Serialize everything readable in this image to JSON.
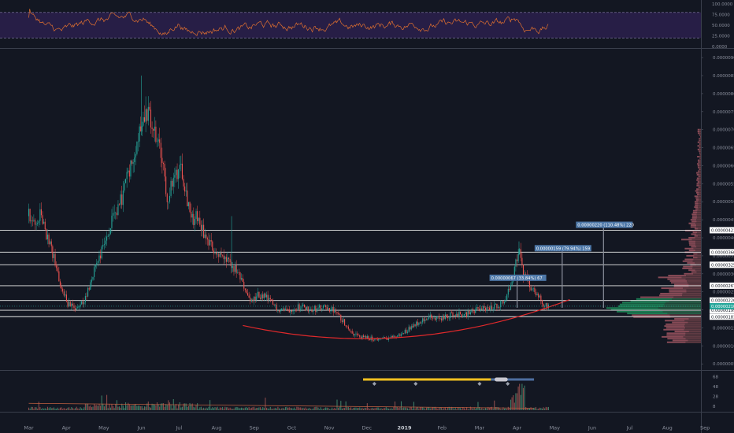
{
  "chart_data": {
    "type": "candlestick",
    "colors": {
      "background": "#131722",
      "up": "#26a69a",
      "down": "#ef5350",
      "rsi": "#e0702f",
      "rsi_band": "#2a1f4a",
      "arc": "#e0292b",
      "level": "#e8e8e8",
      "annotation": "#4e78a8",
      "profile_up": "#1f8f5c",
      "profile_down": "#9e5560",
      "timeline": "#4e6fa0",
      "timeline_fill": "#f0c020"
    },
    "x_axis": {
      "labels": [
        "Mar",
        "Apr",
        "May",
        "Jun",
        "Jul",
        "Aug",
        "Sep",
        "Oct",
        "Nov",
        "Dec",
        "2019",
        "Feb",
        "Mar",
        "Apr",
        "May",
        "Jun",
        "Jul",
        "Aug",
        "Sep"
      ],
      "bold_label": "2019"
    },
    "rsi": {
      "ticks": [
        "100.0000",
        "75.0000",
        "50.0000",
        "25.0000",
        "0.0000"
      ],
      "tick_values": [
        100,
        75,
        50,
        25,
        0
      ],
      "upper": 80,
      "lower": 20
    },
    "price": {
      "ticks": [
        "0.00000900",
        "0.00000850",
        "0.00000800",
        "0.00000750",
        "0.00000700",
        "0.00000650",
        "0.00000600",
        "0.00000550",
        "0.00000500",
        "0.00000450",
        "0.00000400",
        "0.00000350",
        "0.00000300",
        "0.00000250",
        "0.00000200",
        "0.00000150",
        "0.00000100",
        "0.00000050"
      ],
      "tick_values": [
        900,
        850,
        800,
        750,
        700,
        650,
        600,
        550,
        500,
        450,
        400,
        350,
        300,
        250,
        200,
        150,
        100,
        50
      ],
      "ylim": [
        33,
        920
      ],
      "current": "0.00000210",
      "current_value": 210
    },
    "levels": [
      {
        "value": 421,
        "label": "0.00000421"
      },
      {
        "value": 360,
        "label": "0.00000360"
      },
      {
        "value": 325,
        "label": "0.00000325"
      },
      {
        "value": 267,
        "label": "0.00000267"
      },
      {
        "value": 226,
        "label": "0.00000226"
      },
      {
        "value": 199,
        "label": "0.00000199"
      },
      {
        "value": 181,
        "label": "0.00000181"
      }
    ],
    "annotations": [
      {
        "text": "0.00000220 (110.48%) 220",
        "value": 436,
        "t": 15.9
      },
      {
        "text": "0.00000159 (79.94%) 159",
        "value": 371,
        "t": 14.8
      },
      {
        "text": "0.00000067 (33.84%) 67",
        "value": 289,
        "t": 13.6
      }
    ],
    "price_series": [
      [
        0,
        460
      ],
      [
        0.15,
        430
      ],
      [
        0.3,
        460
      ],
      [
        0.5,
        400
      ],
      [
        0.7,
        330
      ],
      [
        0.9,
        250
      ],
      [
        1.05,
        215
      ],
      [
        1.3,
        200
      ],
      [
        1.5,
        230
      ],
      [
        1.8,
        330
      ],
      [
        2.0,
        380
      ],
      [
        2.2,
        440
      ],
      [
        2.4,
        480
      ],
      [
        2.6,
        560
      ],
      [
        2.8,
        640
      ],
      [
        2.95,
        700
      ],
      [
        3.1,
        760
      ],
      [
        3.3,
        700
      ],
      [
        3.5,
        640
      ],
      [
        3.6,
        570
      ],
      [
        3.7,
        510
      ],
      [
        3.9,
        570
      ],
      [
        4.05,
        610
      ],
      [
        4.2,
        520
      ],
      [
        4.35,
        450
      ],
      [
        4.5,
        460
      ],
      [
        4.7,
        400
      ],
      [
        4.9,
        370
      ],
      [
        5.1,
        350
      ],
      [
        5.3,
        330
      ],
      [
        5.5,
        310
      ],
      [
        5.75,
        260
      ],
      [
        5.9,
        220
      ],
      [
        6.1,
        240
      ],
      [
        6.3,
        235
      ],
      [
        6.6,
        205
      ],
      [
        6.9,
        200
      ],
      [
        7.2,
        210
      ],
      [
        7.5,
        202
      ],
      [
        7.8,
        205
      ],
      [
        8.1,
        200
      ],
      [
        8.4,
        165
      ],
      [
        8.6,
        138
      ],
      [
        8.8,
        125
      ],
      [
        9.0,
        122
      ],
      [
        9.3,
        118
      ],
      [
        9.6,
        122
      ],
      [
        9.9,
        130
      ],
      [
        10.2,
        155
      ],
      [
        10.6,
        180
      ],
      [
        11.0,
        175
      ],
      [
        11.3,
        190
      ],
      [
        11.6,
        185
      ],
      [
        11.9,
        200
      ],
      [
        12.3,
        205
      ],
      [
        12.6,
        220
      ],
      [
        12.8,
        255
      ],
      [
        12.95,
        330
      ],
      [
        13.05,
        370
      ],
      [
        13.15,
        300
      ],
      [
        13.3,
        270
      ],
      [
        13.5,
        250
      ],
      [
        13.65,
        220
      ],
      [
        13.85,
        210
      ]
    ],
    "volume": {
      "ticks": [
        "68",
        "48",
        "28",
        "8"
      ],
      "tick_values": [
        68,
        48,
        28,
        8
      ],
      "ylim": [
        0,
        72
      ]
    }
  }
}
